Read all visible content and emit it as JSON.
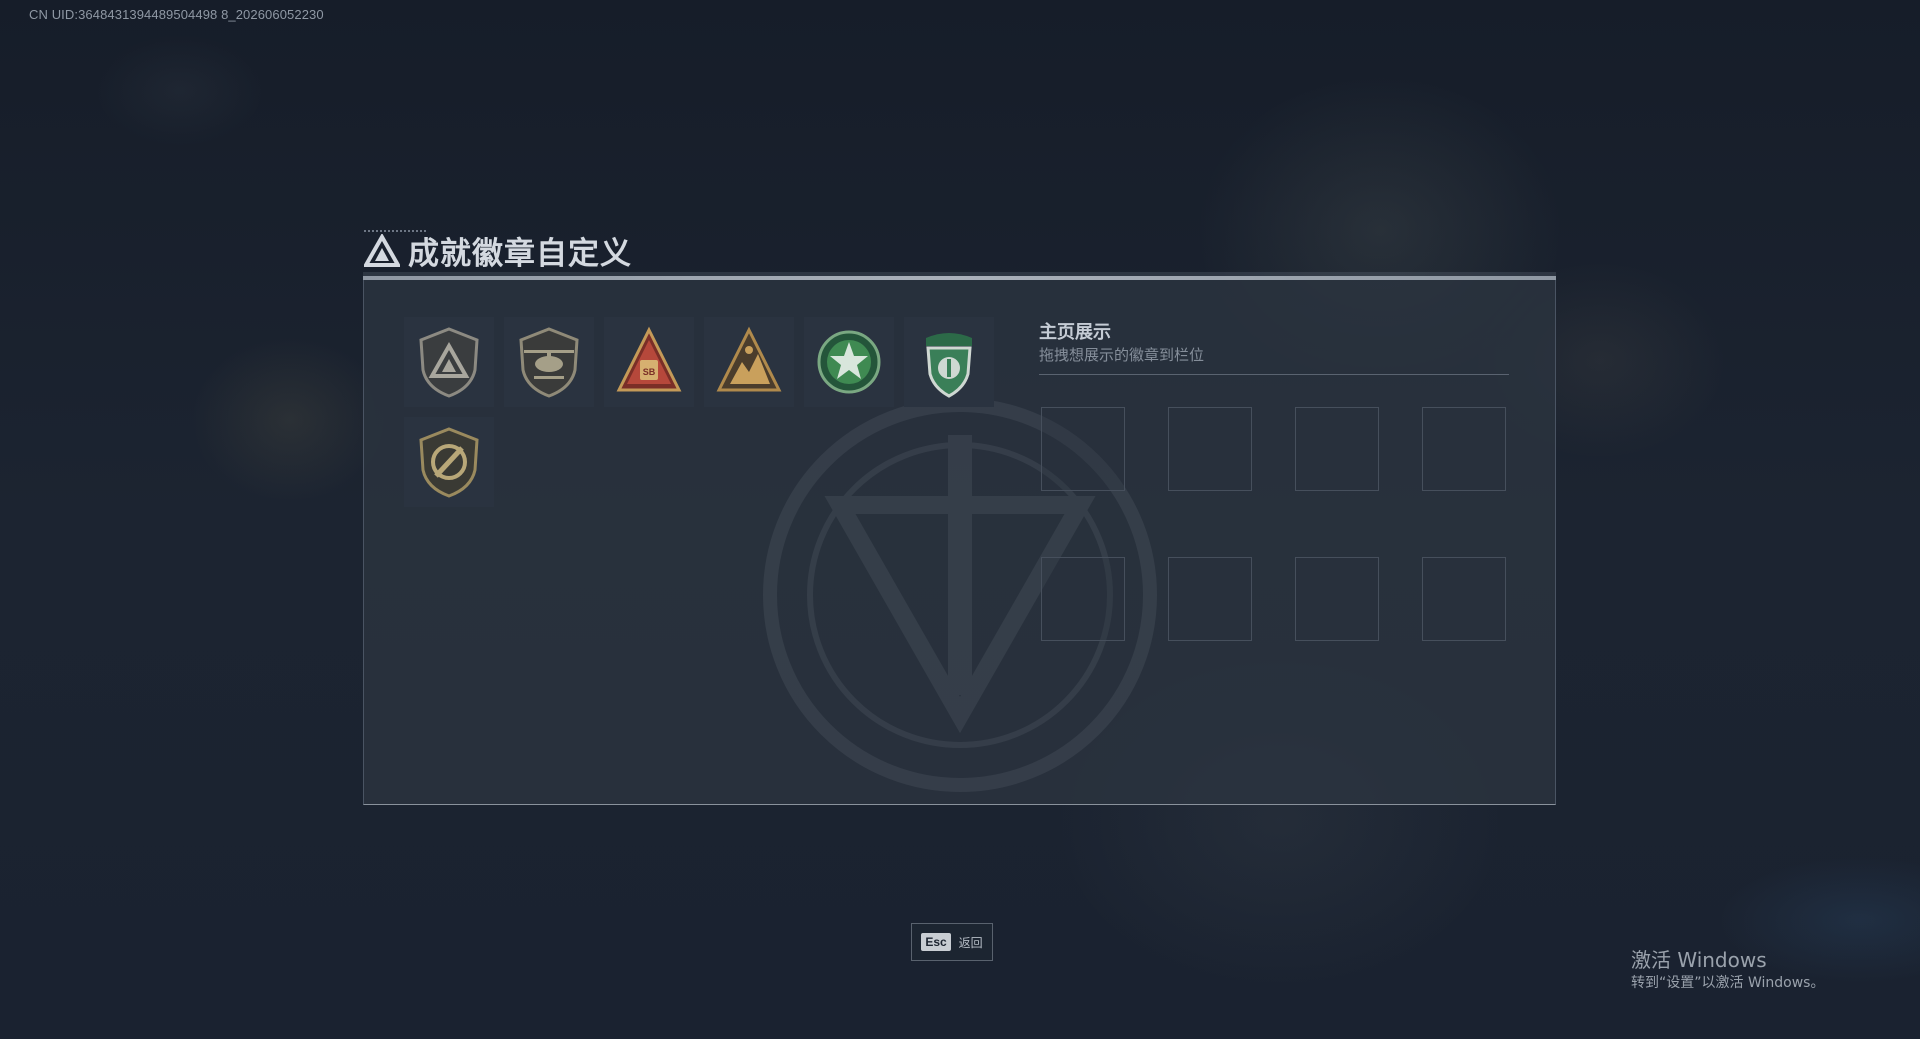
{
  "uid_text": "CN UID:3648431394489504498 8_202606052230",
  "page": {
    "title": "成就徽章自定义"
  },
  "badges": [
    {
      "icon": "shield-triangle-badge-icon",
      "tint": "#8c8a82"
    },
    {
      "icon": "helicopter-shield-badge-icon",
      "tint": "#8f8a78"
    },
    {
      "icon": "red-triangle-sb-badge-icon",
      "tint": "#b6483b",
      "label": "SB"
    },
    {
      "icon": "mountain-triangle-badge-icon",
      "tint": "#b08a4c"
    },
    {
      "icon": "green-star-medal-badge-icon",
      "tint": "#3f8a52"
    },
    {
      "icon": "green-winged-shield-badge-icon",
      "tint": "#3a7f58"
    },
    {
      "icon": "slashed-shield-badge-icon",
      "tint": "#9a8a5e"
    }
  ],
  "showcase": {
    "title": "主页展示",
    "subtitle": "拖拽想展示的徽章到栏位",
    "slot_count": 8
  },
  "footer": {
    "esc_key": "Esc",
    "esc_label": "返回"
  },
  "windows_watermark": {
    "title": "激活 Windows",
    "subtitle": "转到“设置”以激活 Windows。"
  }
}
